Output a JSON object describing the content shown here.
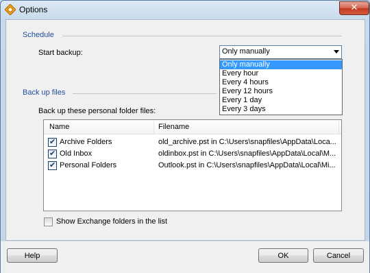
{
  "window": {
    "title": "Options",
    "close_glyph": "✕"
  },
  "schedule": {
    "group_label": "Schedule",
    "start_backup_label": "Start backup:",
    "selected": "Only manually",
    "options": [
      "Only manually",
      "Every hour",
      "Every 4 hours",
      "Every 12 hours",
      "Every 1 day",
      "Every 3 days"
    ]
  },
  "backup_files": {
    "group_label": "Back up files",
    "list_label": "Back up these personal folder files:",
    "columns": [
      "Name",
      "Filename"
    ],
    "rows": [
      {
        "name": "Archive Folders",
        "filename": "old_archive.pst in C:\\Users\\snapfiles\\AppData\\Loca...",
        "checked": true
      },
      {
        "name": "Old Inbox",
        "filename": "oldinbox.pst in C:\\Users\\snapfiles\\AppData\\Local\\M...",
        "checked": true
      },
      {
        "name": "Personal Folders",
        "filename": "Outlook.pst in C:\\Users\\snapfiles\\AppData\\Local\\Mi...",
        "checked": true
      }
    ],
    "exchange_checkbox_label": "Show Exchange folders in the list",
    "exchange_checked": false
  },
  "buttons": {
    "help": "Help",
    "ok": "OK",
    "cancel": "Cancel"
  },
  "check_glyph": "✔",
  "icons": {
    "app": "outlook-backup-icon",
    "close": "close-icon",
    "combo_arrow": "chevron-down-icon"
  }
}
